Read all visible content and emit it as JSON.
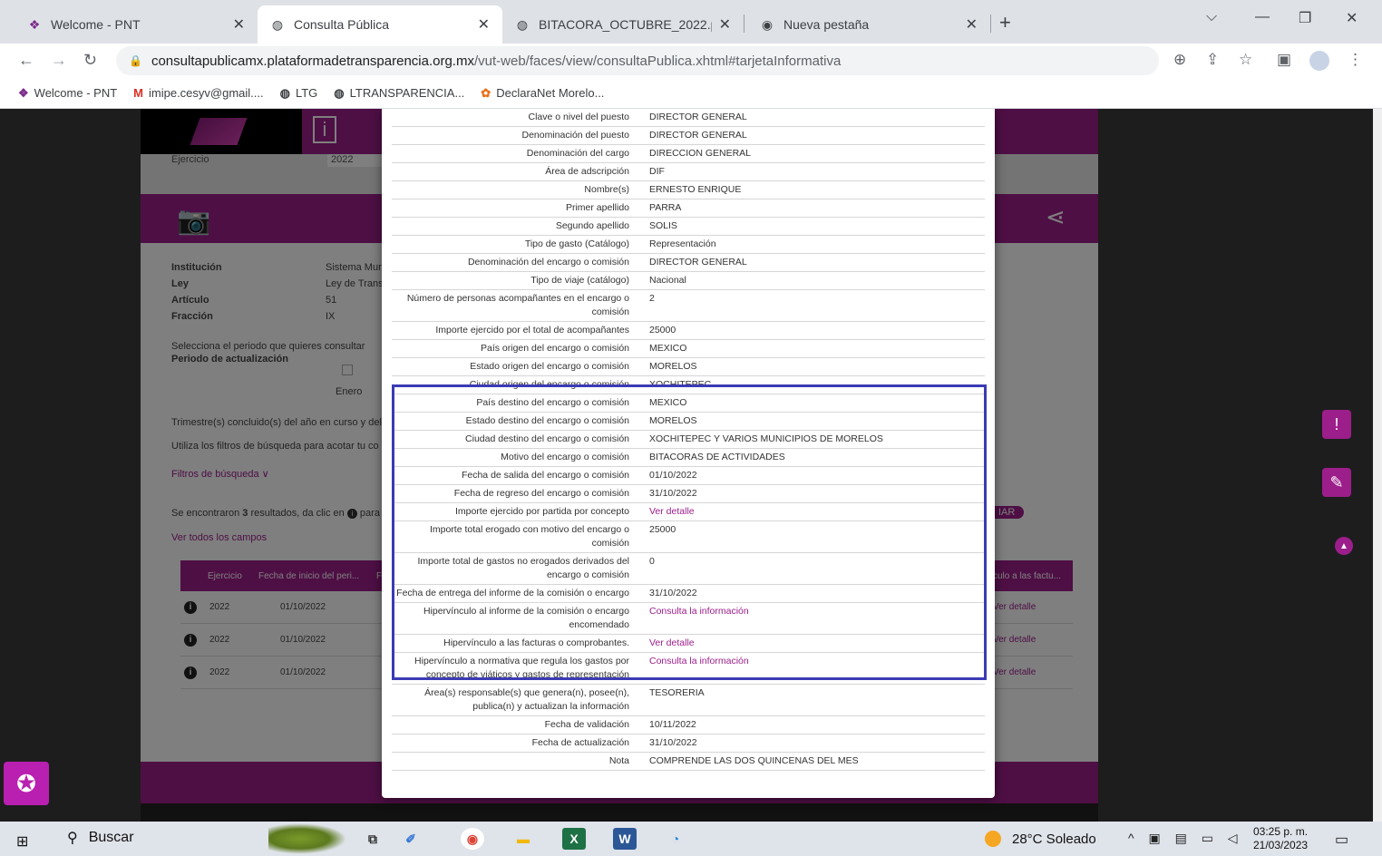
{
  "browser": {
    "tabs": [
      {
        "title": "Welcome - PNT",
        "icon": "pnt-logo-icon",
        "active": false
      },
      {
        "title": "Consulta Pública",
        "icon": "globe-icon",
        "active": true
      },
      {
        "title": "BITACORA_OCTUBRE_2022.pdf",
        "icon": "globe-icon",
        "active": false
      },
      {
        "title": "Nueva pestaña",
        "icon": "chrome-icon",
        "active": false
      }
    ],
    "url_host": "consultapublicamx.plataformadetransparencia.org.mx",
    "url_path": "/vut-web/faces/view/consultaPublica.xhtml#tarjetaInformativa",
    "bookmarks": [
      {
        "label": "Welcome - PNT",
        "icon": "pnt-logo-icon"
      },
      {
        "label": "imipe.cesyv@gmail....",
        "icon": "gmail-icon"
      },
      {
        "label": "LTG",
        "icon": "globe-icon"
      },
      {
        "label": "LTRANSPARENCIA...",
        "icon": "globe-icon"
      },
      {
        "label": "DeclaraNet Morelo...",
        "icon": "declaranet-icon"
      }
    ]
  },
  "background_page": {
    "ejercicio_label": "Ejercicio",
    "ejercicio_value": "2022",
    "info": [
      {
        "label": "Institución",
        "value": "Sistema Mur"
      },
      {
        "label": "Ley",
        "value": "Ley de Trans"
      },
      {
        "label": "Artículo",
        "value": "51"
      },
      {
        "label": "Fracción",
        "value": "IX"
      }
    ],
    "period_prompt": "Selecciona el periodo que quieres consultar",
    "period_label": "Periodo de actualización",
    "month_label": "Enero",
    "trimestre_text": "Trimestre(s) concluido(s) del año en curso y del",
    "filters_hint": "Utiliza los filtros de búsqueda para acotar tu co",
    "filters_toggle": "Filtros de búsqueda ∨",
    "results_text_pre": "Se encontraron ",
    "results_count": "3",
    "results_text_post": " resultados, da clic en",
    "results_text_tail": " para",
    "ver_todos": "Ver todos los campos",
    "action_fragment": "IAR",
    "table_headers": [
      "Ejercicio",
      "Fecha de inicio del peri...",
      "F",
      "culo a las factu..."
    ],
    "rows": [
      {
        "ejercicio": "2022",
        "fecha": "01/10/2022",
        "link": "Ver detalle"
      },
      {
        "ejercicio": "2022",
        "fecha": "01/10/2022",
        "link": "Ver detalle"
      },
      {
        "ejercicio": "2022",
        "fecha": "01/10/2022",
        "link": "Ver detalle"
      }
    ]
  },
  "detail_rows": [
    {
      "k": "Clave o nivel del puesto",
      "v": "DIRECTOR GENERAL"
    },
    {
      "k": "Denominación del puesto",
      "v": "DIRECTOR GENERAL"
    },
    {
      "k": "Denominación del cargo",
      "v": "DIRECCION GENERAL"
    },
    {
      "k": "Área de adscripción",
      "v": "DIF"
    },
    {
      "k": "Nombre(s)",
      "v": "ERNESTO ENRIQUE"
    },
    {
      "k": "Primer apellido",
      "v": "PARRA"
    },
    {
      "k": "Segundo apellido",
      "v": "SOLIS"
    },
    {
      "k": "Tipo de gasto (Catálogo)",
      "v": "Representación"
    },
    {
      "k": "Denominación del encargo o comisión",
      "v": "DIRECTOR GENERAL"
    },
    {
      "k": "Tipo de viaje (catálogo)",
      "v": "Nacional"
    },
    {
      "k": "Número de personas acompañantes en el encargo o comisión",
      "v": "2"
    },
    {
      "k": "Importe ejercido por el total de acompañantes",
      "v": "25000"
    },
    {
      "k": "País origen del encargo o comisión",
      "v": "MEXICO"
    },
    {
      "k": "Estado origen del encargo o comisión",
      "v": "MORELOS"
    },
    {
      "k": "Ciudad origen del encargo o comisión",
      "v": "XOCHITEPEC"
    },
    {
      "k": "País destino del encargo o comisión",
      "v": "MEXICO"
    },
    {
      "k": "Estado destino del encargo o comisión",
      "v": "MORELOS"
    },
    {
      "k": "Ciudad destino del encargo o comisión",
      "v": "XOCHITEPEC Y VARIOS MUNICIPIOS DE MORELOS"
    },
    {
      "k": "Motivo del encargo o comisión",
      "v": "BITACORAS DE ACTIVIDADES"
    },
    {
      "k": "Fecha de salida del encargo o comisión",
      "v": "01/10/2022"
    },
    {
      "k": "Fecha de regreso del encargo o comisión",
      "v": "31/10/2022"
    },
    {
      "k": "Importe ejercido por partida por concepto",
      "v": "Ver detalle",
      "link": true
    },
    {
      "k": "Importe total erogado con motivo del encargo o comisión",
      "v": "25000"
    },
    {
      "k": "Importe total de gastos no erogados derivados del encargo o comisión",
      "v": "0"
    },
    {
      "k": "Fecha de entrega del informe de la comisión o encargo",
      "v": "31/10/2022"
    },
    {
      "k": "Hipervínculo al informe de la comisión o encargo encomendado",
      "v": "Consulta la información",
      "link": true
    },
    {
      "k": "Hipervínculo a las facturas o comprobantes.",
      "v": "Ver detalle",
      "link": true
    },
    {
      "k": "Hipervínculo a normativa que regula los gastos por concepto de viáticos y gastos de representación",
      "v": "Consulta la información",
      "link": true
    },
    {
      "k": "Área(s) responsable(s) que genera(n), posee(n), publica(n) y actualizan la información",
      "v": "TESORERIA"
    },
    {
      "k": "Fecha de validación",
      "v": "10/11/2022"
    },
    {
      "k": "Fecha de actualización",
      "v": "31/10/2022"
    },
    {
      "k": "Nota",
      "v": "COMPRENDE LAS DOS QUINCENAS DEL MES"
    }
  ],
  "taskbar": {
    "search_label": "Buscar",
    "weather": "28°C Soleado",
    "time": "03:25 p. m.",
    "date": "21/03/2023"
  },
  "colors": {
    "brand_purple": "#9c1e8a",
    "highlight_blue": "#3b3bb5"
  }
}
